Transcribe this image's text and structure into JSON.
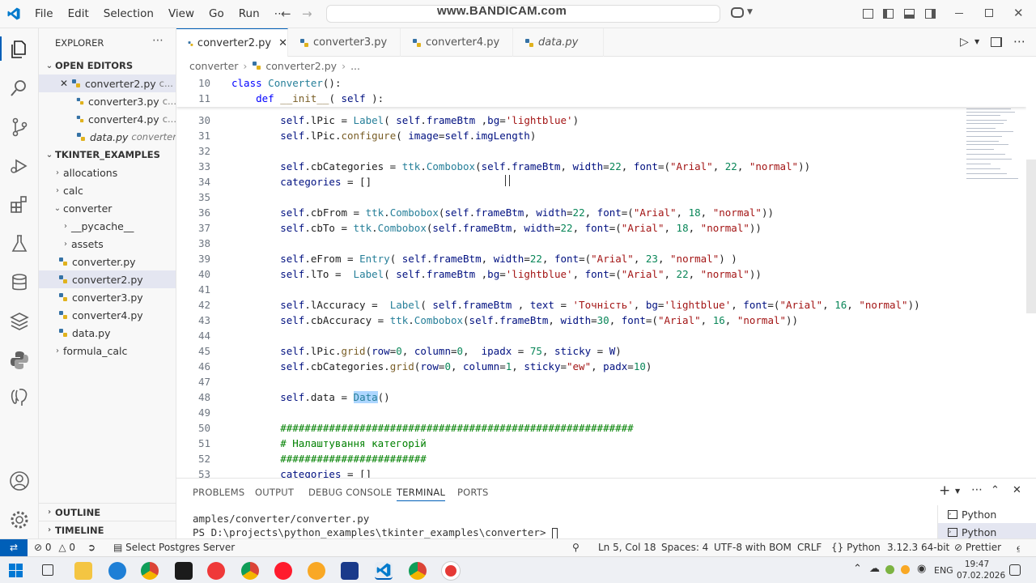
{
  "watermark": "www.BANDICAM.com",
  "menu": [
    "File",
    "Edit",
    "Selection",
    "View",
    "Go",
    "Run",
    "⋯"
  ],
  "sidebar": {
    "title": "EXPLORER",
    "open_editors_label": "OPEN EDITORS",
    "open_editors": [
      {
        "name": "converter2.py",
        "dir": "c..."
      },
      {
        "name": "converter3.py",
        "dir": "c..."
      },
      {
        "name": "converter4.py",
        "dir": "c..."
      },
      {
        "name": "data.py",
        "dir": "converter"
      }
    ],
    "workspace_label": "TKINTER_EXAMPLES",
    "tree": [
      {
        "name": "allocations",
        "type": "folder",
        "open": false,
        "depth": 1
      },
      {
        "name": "calc",
        "type": "folder",
        "open": false,
        "depth": 1
      },
      {
        "name": "converter",
        "type": "folder",
        "open": true,
        "depth": 1
      },
      {
        "name": "__pycache__",
        "type": "folder",
        "open": false,
        "depth": 2
      },
      {
        "name": "assets",
        "type": "folder",
        "open": false,
        "depth": 2
      },
      {
        "name": "converter.py",
        "type": "file",
        "depth": 2
      },
      {
        "name": "converter2.py",
        "type": "file",
        "depth": 2,
        "selected": true
      },
      {
        "name": "converter3.py",
        "type": "file",
        "depth": 2
      },
      {
        "name": "converter4.py",
        "type": "file",
        "depth": 2
      },
      {
        "name": "data.py",
        "type": "file",
        "depth": 2
      },
      {
        "name": "formula_calc",
        "type": "folder",
        "open": false,
        "depth": 1
      }
    ],
    "outline_label": "OUTLINE",
    "timeline_label": "TIMELINE"
  },
  "tabs": [
    {
      "label": "converter2.py",
      "active": true
    },
    {
      "label": "converter3.py",
      "active": false
    },
    {
      "label": "converter4.py",
      "active": false
    },
    {
      "label": "data.py",
      "active": false
    }
  ],
  "breadcrumb": {
    "folder": "converter",
    "file": "converter2.py",
    "more": "..."
  },
  "sticky_lines": [
    {
      "n": "10",
      "code": "class Converter():"
    },
    {
      "n": "11",
      "code": "    def __init__( self ):"
    }
  ],
  "code_lines": [
    {
      "n": "30",
      "code": "        self.lPic = Label( self.frameBtm ,bg='lightblue')"
    },
    {
      "n": "31",
      "code": "        self.lPic.configure( image=self.imgLength)"
    },
    {
      "n": "32",
      "code": ""
    },
    {
      "n": "33",
      "code": "        self.cbCategories = ttk.Combobox(self.frameBtm, width=22, font=(\"Arial\", 22, \"normal\"))"
    },
    {
      "n": "34",
      "code": "        categories = []"
    },
    {
      "n": "35",
      "code": ""
    },
    {
      "n": "36",
      "code": "        self.cbFrom = ttk.Combobox(self.frameBtm, width=22, font=(\"Arial\", 18, \"normal\"))"
    },
    {
      "n": "37",
      "code": "        self.cbTo = ttk.Combobox(self.frameBtm, width=22, font=(\"Arial\", 18, \"normal\"))"
    },
    {
      "n": "38",
      "code": ""
    },
    {
      "n": "39",
      "code": "        self.eFrom = Entry( self.frameBtm, width=22, font=(\"Arial\", 23, \"normal\") )"
    },
    {
      "n": "40",
      "code": "        self.lTo =  Label( self.frameBtm ,bg='lightblue', font=(\"Arial\", 22, \"normal\"))"
    },
    {
      "n": "41",
      "code": ""
    },
    {
      "n": "42",
      "code": "        self.lAccuracy =  Label( self.frameBtm , text = 'Точність', bg='lightblue', font=(\"Arial\", 16, \"normal\"))"
    },
    {
      "n": "43",
      "code": "        self.cbAccuracy = ttk.Combobox(self.frameBtm, width=30, font=(\"Arial\", 16, \"normal\"))"
    },
    {
      "n": "44",
      "code": ""
    },
    {
      "n": "45",
      "code": "        self.lPic.grid(row=0, column=0,  ipadx = 75, sticky = W)"
    },
    {
      "n": "46",
      "code": "        self.cbCategories.grid(row=0, column=1, sticky=\"ew\", padx=10)"
    },
    {
      "n": "47",
      "code": ""
    },
    {
      "n": "48",
      "code": "        self.data = Data()"
    },
    {
      "n": "49",
      "code": ""
    },
    {
      "n": "50",
      "code": "        ##########################################################"
    },
    {
      "n": "51",
      "code": "        # Налаштування категорій"
    },
    {
      "n": "52",
      "code": "        ########################"
    },
    {
      "n": "53",
      "code": "        categories = []"
    }
  ],
  "panel": {
    "tabs": [
      "PROBLEMS",
      "OUTPUT",
      "DEBUG CONSOLE",
      "TERMINAL",
      "PORTS"
    ],
    "active_tab": "TERMINAL",
    "terminal_lines": [
      "amples/converter/converter.py",
      "PS D:\\projects\\python_examples\\tkinter_examples\\converter> "
    ],
    "terminal_list": [
      "Python",
      "Python"
    ]
  },
  "status": {
    "errors": "0",
    "warnings": "0",
    "postgres": "Select Postgres Server",
    "position": "Ln 5, Col 18",
    "spaces": "Spaces: 4",
    "encoding": "UTF-8 with BOM",
    "eol": "CRLF",
    "language": "Python",
    "interpreter": "3.12.3 64-bit",
    "prettier": "Prettier"
  },
  "taskbar": {
    "lang": "ENG",
    "time": "19:47",
    "date": "07.02.2026"
  },
  "colors": {
    "accent": "#005fb8",
    "vscode_blue": "#007acc"
  }
}
